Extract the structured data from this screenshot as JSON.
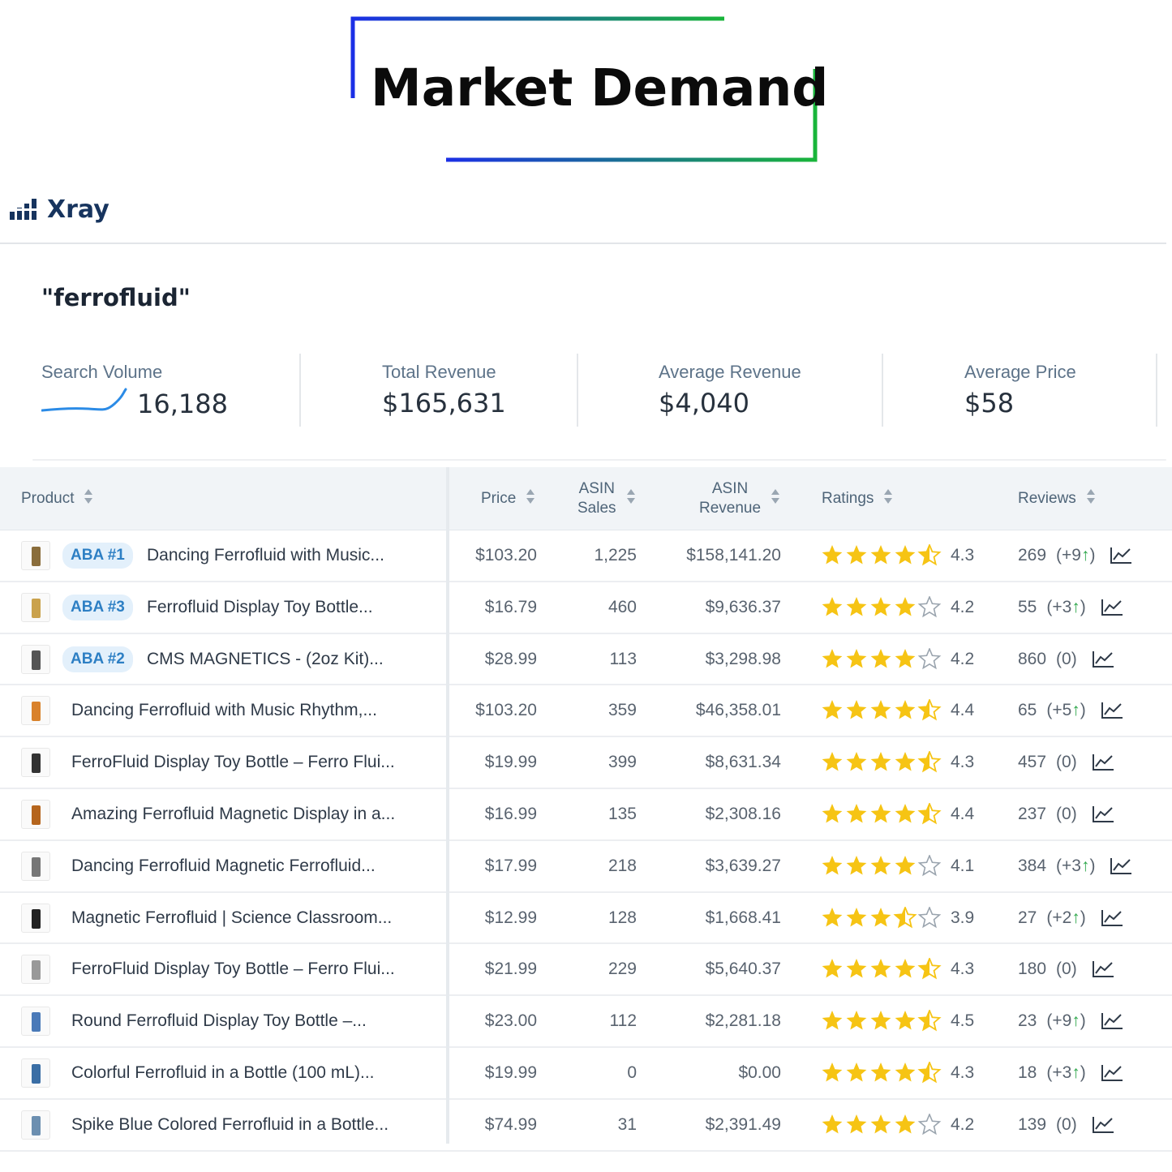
{
  "heading": {
    "title": "Market Demand"
  },
  "brand": {
    "name": "Xray"
  },
  "keyword": "\"ferrofluid\"",
  "stats": {
    "search_volume": {
      "label": "Search Volume",
      "value": "16,188"
    },
    "total_revenue": {
      "label": "Total Revenue",
      "value": "$165,631"
    },
    "average_revenue": {
      "label": "Average Revenue",
      "value": "$4,040"
    },
    "average_price": {
      "label": "Average Price",
      "value": "$58"
    }
  },
  "table": {
    "headers": {
      "product": "Product",
      "price": "Price",
      "asin_sales_1": "ASIN",
      "asin_sales_2": "Sales",
      "asin_revenue_1": "ASIN",
      "asin_revenue_2": "Revenue",
      "ratings": "Ratings",
      "reviews": "Reviews"
    },
    "rows": [
      {
        "aba": "ABA #1",
        "name": "Dancing Ferrofluid with Music...",
        "price": "$103.20",
        "sales": "1,225",
        "revenue": "$158,141.20",
        "rating": "4.3",
        "reviews": "269",
        "change": "(+9",
        "up": true
      },
      {
        "aba": "ABA #3",
        "name": "Ferrofluid Display Toy Bottle...",
        "price": "$16.79",
        "sales": "460",
        "revenue": "$9,636.37",
        "rating": "4.2",
        "reviews": "55",
        "change": "(+3",
        "up": true
      },
      {
        "aba": "ABA #2",
        "name": "CMS MAGNETICS - (2oz Kit)...",
        "price": "$28.99",
        "sales": "113",
        "revenue": "$3,298.98",
        "rating": "4.2",
        "reviews": "860",
        "change": "(0)",
        "up": false
      },
      {
        "aba": "",
        "name": "Dancing Ferrofluid with Music Rhythm,...",
        "price": "$103.20",
        "sales": "359",
        "revenue": "$46,358.01",
        "rating": "4.4",
        "reviews": "65",
        "change": "(+5",
        "up": true
      },
      {
        "aba": "",
        "name": "FerroFluid Display Toy Bottle – Ferro Flui...",
        "price": "$19.99",
        "sales": "399",
        "revenue": "$8,631.34",
        "rating": "4.3",
        "reviews": "457",
        "change": "(0)",
        "up": false
      },
      {
        "aba": "",
        "name": "Amazing Ferrofluid Magnetic Display in a...",
        "price": "$16.99",
        "sales": "135",
        "revenue": "$2,308.16",
        "rating": "4.4",
        "reviews": "237",
        "change": "(0)",
        "up": false
      },
      {
        "aba": "",
        "name": "Dancing Ferrofluid Magnetic Ferrofluid...",
        "price": "$17.99",
        "sales": "218",
        "revenue": "$3,639.27",
        "rating": "4.1",
        "reviews": "384",
        "change": "(+3",
        "up": true
      },
      {
        "aba": "",
        "name": "Magnetic Ferrofluid | Science Classroom...",
        "price": "$12.99",
        "sales": "128",
        "revenue": "$1,668.41",
        "rating": "3.9",
        "reviews": "27",
        "change": "(+2",
        "up": true
      },
      {
        "aba": "",
        "name": "FerroFluid Display Toy Bottle – Ferro Flui...",
        "price": "$21.99",
        "sales": "229",
        "revenue": "$5,640.37",
        "rating": "4.3",
        "reviews": "180",
        "change": "(0)",
        "up": false
      },
      {
        "aba": "",
        "name": "Round Ferrofluid Display Toy Bottle –...",
        "price": "$23.00",
        "sales": "112",
        "revenue": "$2,281.18",
        "rating": "4.5",
        "reviews": "23",
        "change": "(+9",
        "up": true
      },
      {
        "aba": "",
        "name": "Colorful Ferrofluid in a Bottle (100 mL)...",
        "price": "$19.99",
        "sales": "0",
        "revenue": "$0.00",
        "rating": "4.3",
        "reviews": "18",
        "change": "(+3",
        "up": true
      },
      {
        "aba": "",
        "name": "Spike Blue Colored Ferrofluid in a Bottle...",
        "price": "$74.99",
        "sales": "31",
        "revenue": "$2,391.49",
        "rating": "4.2",
        "reviews": "139",
        "change": "(0)",
        "up": false
      }
    ]
  },
  "colors": {
    "star": "#f6c414",
    "star_empty": "#9aa4ae",
    "accent_blue": "#1d3fe0",
    "accent_green": "#17a64a",
    "brand": "#17345e",
    "up_arrow": "#2fa74c"
  },
  "icons": {
    "brand": "bar-chart-icon",
    "sort": "sort-icon",
    "trend": "trend-chart-icon",
    "star": "star-icon"
  }
}
